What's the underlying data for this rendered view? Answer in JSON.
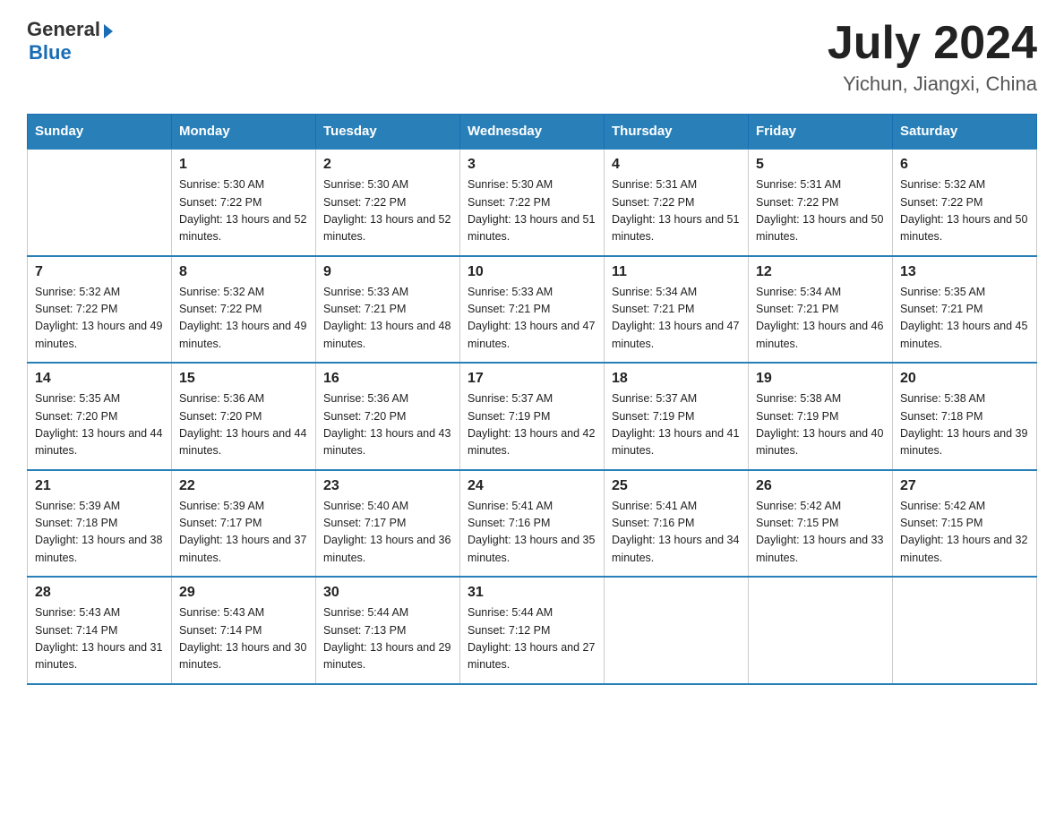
{
  "header": {
    "logo_general": "General",
    "logo_blue": "Blue",
    "title": "July 2024",
    "subtitle": "Yichun, Jiangxi, China"
  },
  "weekdays": [
    "Sunday",
    "Monday",
    "Tuesday",
    "Wednesday",
    "Thursday",
    "Friday",
    "Saturday"
  ],
  "weeks": [
    [
      null,
      {
        "day": 1,
        "sunrise": "5:30 AM",
        "sunset": "7:22 PM",
        "daylight": "13 hours and 52 minutes."
      },
      {
        "day": 2,
        "sunrise": "5:30 AM",
        "sunset": "7:22 PM",
        "daylight": "13 hours and 52 minutes."
      },
      {
        "day": 3,
        "sunrise": "5:30 AM",
        "sunset": "7:22 PM",
        "daylight": "13 hours and 51 minutes."
      },
      {
        "day": 4,
        "sunrise": "5:31 AM",
        "sunset": "7:22 PM",
        "daylight": "13 hours and 51 minutes."
      },
      {
        "day": 5,
        "sunrise": "5:31 AM",
        "sunset": "7:22 PM",
        "daylight": "13 hours and 50 minutes."
      },
      {
        "day": 6,
        "sunrise": "5:32 AM",
        "sunset": "7:22 PM",
        "daylight": "13 hours and 50 minutes."
      }
    ],
    [
      {
        "day": 7,
        "sunrise": "5:32 AM",
        "sunset": "7:22 PM",
        "daylight": "13 hours and 49 minutes."
      },
      {
        "day": 8,
        "sunrise": "5:32 AM",
        "sunset": "7:22 PM",
        "daylight": "13 hours and 49 minutes."
      },
      {
        "day": 9,
        "sunrise": "5:33 AM",
        "sunset": "7:21 PM",
        "daylight": "13 hours and 48 minutes."
      },
      {
        "day": 10,
        "sunrise": "5:33 AM",
        "sunset": "7:21 PM",
        "daylight": "13 hours and 47 minutes."
      },
      {
        "day": 11,
        "sunrise": "5:34 AM",
        "sunset": "7:21 PM",
        "daylight": "13 hours and 47 minutes."
      },
      {
        "day": 12,
        "sunrise": "5:34 AM",
        "sunset": "7:21 PM",
        "daylight": "13 hours and 46 minutes."
      },
      {
        "day": 13,
        "sunrise": "5:35 AM",
        "sunset": "7:21 PM",
        "daylight": "13 hours and 45 minutes."
      }
    ],
    [
      {
        "day": 14,
        "sunrise": "5:35 AM",
        "sunset": "7:20 PM",
        "daylight": "13 hours and 44 minutes."
      },
      {
        "day": 15,
        "sunrise": "5:36 AM",
        "sunset": "7:20 PM",
        "daylight": "13 hours and 44 minutes."
      },
      {
        "day": 16,
        "sunrise": "5:36 AM",
        "sunset": "7:20 PM",
        "daylight": "13 hours and 43 minutes."
      },
      {
        "day": 17,
        "sunrise": "5:37 AM",
        "sunset": "7:19 PM",
        "daylight": "13 hours and 42 minutes."
      },
      {
        "day": 18,
        "sunrise": "5:37 AM",
        "sunset": "7:19 PM",
        "daylight": "13 hours and 41 minutes."
      },
      {
        "day": 19,
        "sunrise": "5:38 AM",
        "sunset": "7:19 PM",
        "daylight": "13 hours and 40 minutes."
      },
      {
        "day": 20,
        "sunrise": "5:38 AM",
        "sunset": "7:18 PM",
        "daylight": "13 hours and 39 minutes."
      }
    ],
    [
      {
        "day": 21,
        "sunrise": "5:39 AM",
        "sunset": "7:18 PM",
        "daylight": "13 hours and 38 minutes."
      },
      {
        "day": 22,
        "sunrise": "5:39 AM",
        "sunset": "7:17 PM",
        "daylight": "13 hours and 37 minutes."
      },
      {
        "day": 23,
        "sunrise": "5:40 AM",
        "sunset": "7:17 PM",
        "daylight": "13 hours and 36 minutes."
      },
      {
        "day": 24,
        "sunrise": "5:41 AM",
        "sunset": "7:16 PM",
        "daylight": "13 hours and 35 minutes."
      },
      {
        "day": 25,
        "sunrise": "5:41 AM",
        "sunset": "7:16 PM",
        "daylight": "13 hours and 34 minutes."
      },
      {
        "day": 26,
        "sunrise": "5:42 AM",
        "sunset": "7:15 PM",
        "daylight": "13 hours and 33 minutes."
      },
      {
        "day": 27,
        "sunrise": "5:42 AM",
        "sunset": "7:15 PM",
        "daylight": "13 hours and 32 minutes."
      }
    ],
    [
      {
        "day": 28,
        "sunrise": "5:43 AM",
        "sunset": "7:14 PM",
        "daylight": "13 hours and 31 minutes."
      },
      {
        "day": 29,
        "sunrise": "5:43 AM",
        "sunset": "7:14 PM",
        "daylight": "13 hours and 30 minutes."
      },
      {
        "day": 30,
        "sunrise": "5:44 AM",
        "sunset": "7:13 PM",
        "daylight": "13 hours and 29 minutes."
      },
      {
        "day": 31,
        "sunrise": "5:44 AM",
        "sunset": "7:12 PM",
        "daylight": "13 hours and 27 minutes."
      },
      null,
      null,
      null
    ]
  ]
}
